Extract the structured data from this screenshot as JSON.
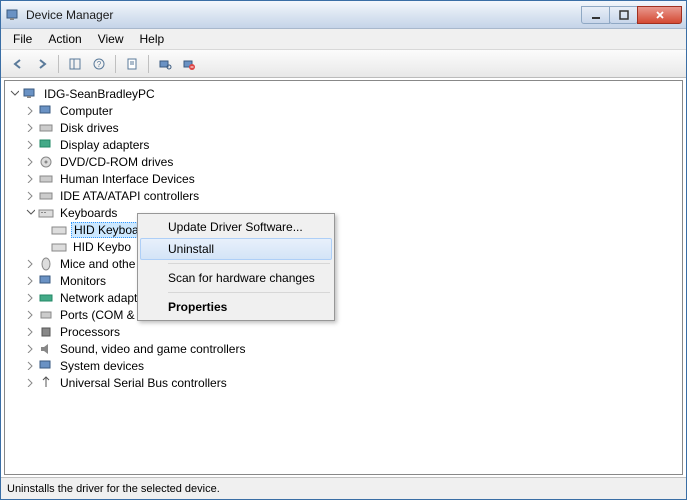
{
  "title": "Device Manager",
  "menus": {
    "file": "File",
    "action": "Action",
    "view": "View",
    "help": "Help"
  },
  "tree": {
    "root": "IDG-SeanBradleyPC",
    "nodes": {
      "computer": "Computer",
      "diskdrives": "Disk drives",
      "display": "Display adapters",
      "dvd": "DVD/CD-ROM drives",
      "hid": "Human Interface Devices",
      "ide": "IDE ATA/ATAPI controllers",
      "keyboards": "Keyboards",
      "kbd1": "HID Keyboard Device",
      "kbd2": "HID Keybo",
      "mice": "Mice and othe",
      "monitors": "Monitors",
      "network": "Network adapt",
      "ports": "Ports (COM &",
      "processors": "Processors",
      "sound": "Sound, video and game controllers",
      "system": "System devices",
      "usb": "Universal Serial Bus controllers"
    }
  },
  "context_menu": {
    "update": "Update Driver Software...",
    "uninstall": "Uninstall",
    "scan": "Scan for hardware changes",
    "properties": "Properties"
  },
  "statusbar": "Uninstalls the driver for the selected device."
}
